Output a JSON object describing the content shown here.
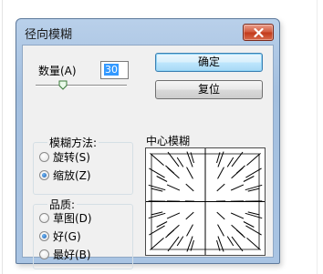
{
  "window": {
    "title": "径向模糊"
  },
  "amount": {
    "label": "数量(A)",
    "value": "30",
    "slider_fraction": 0.3
  },
  "buttons": {
    "ok": "确定",
    "reset": "复位"
  },
  "blur_method": {
    "legend": "模糊方法:",
    "options": [
      {
        "label": "旋转(S)",
        "checked": false
      },
      {
        "label": "缩放(Z)",
        "checked": true
      }
    ]
  },
  "quality": {
    "legend": "品质:",
    "options": [
      {
        "label": "草图(D)",
        "checked": false
      },
      {
        "label": "好(G)",
        "checked": true
      },
      {
        "label": "最好(B)",
        "checked": false
      }
    ]
  },
  "preview": {
    "label": "中心模糊"
  },
  "colors": {
    "title_bar": "#a9c4e3",
    "close_button": "#c2391a",
    "dialog_bg": "#f0f0f0"
  },
  "icons": {
    "close": "close-icon",
    "slider_thumb": "slider-thumb-icon"
  }
}
